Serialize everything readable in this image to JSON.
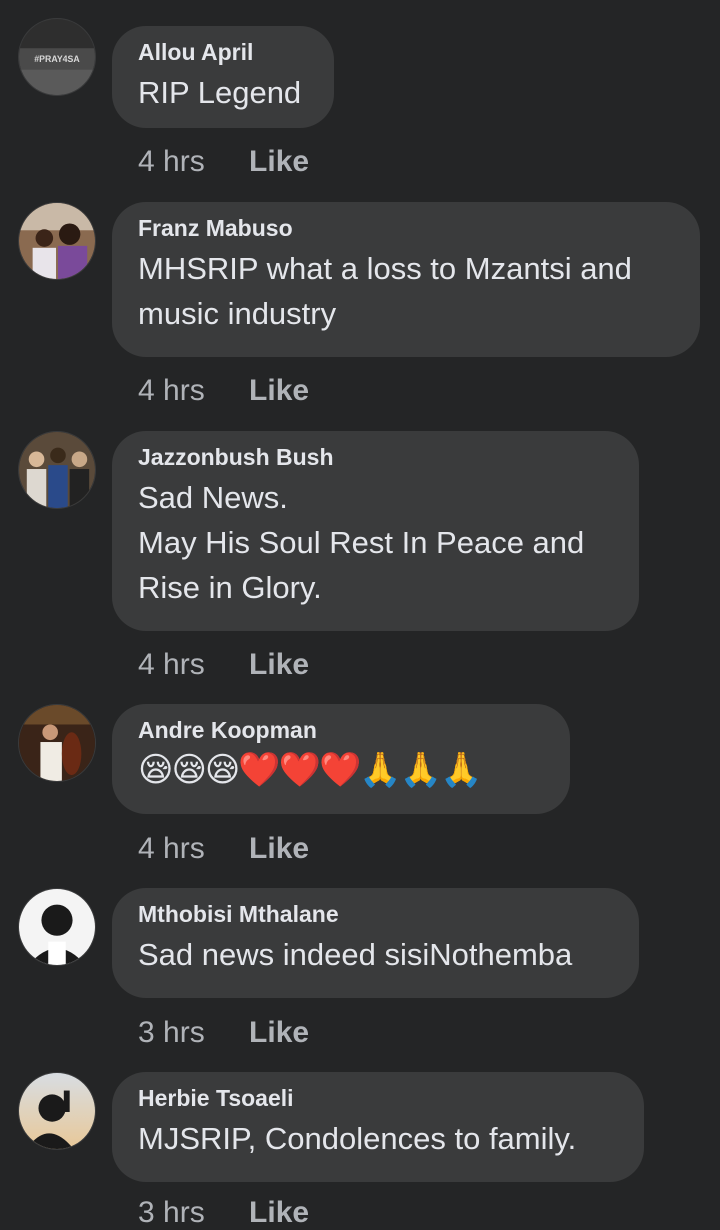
{
  "comments": [
    {
      "author": "Allou April",
      "text": "RIP Legend",
      "time": "4 hrs",
      "like_label": "Like",
      "avatar_text": "#PRAY4SA"
    },
    {
      "author": "Franz Mabuso",
      "text": "MHSRIP what a loss to Mzantsi and music industry",
      "time": "4 hrs",
      "like_label": "Like"
    },
    {
      "author": "Jazzonbush Bush",
      "text": "Sad News.\nMay His Soul Rest In Peace and Rise in Glory.",
      "time": "4 hrs",
      "like_label": "Like"
    },
    {
      "author": "Andre Koopman",
      "text": "😪😪😪❤️❤️❤️🙏🙏🙏",
      "time": "4 hrs",
      "like_label": "Like"
    },
    {
      "author": "Mthobisi Mthalane",
      "text": "Sad news indeed sisiNothemba",
      "time": "3 hrs",
      "like_label": "Like"
    },
    {
      "author": "Herbie Tsoaeli",
      "text": "MJSRIP, Condolences to family.",
      "time": "3 hrs",
      "like_label": "Like"
    }
  ]
}
